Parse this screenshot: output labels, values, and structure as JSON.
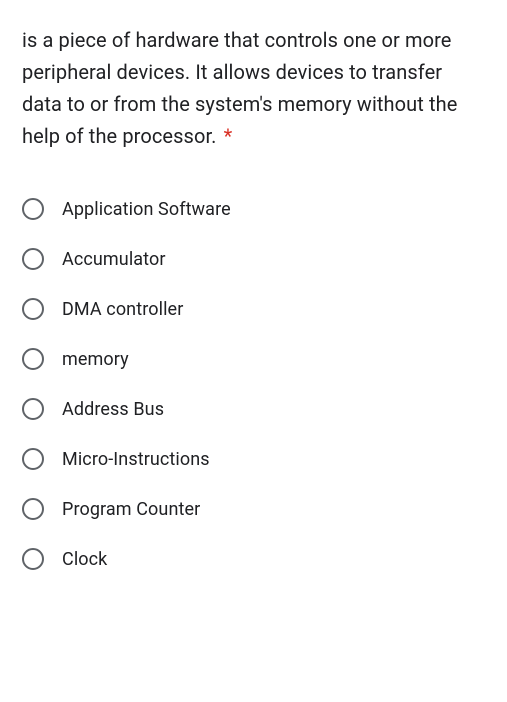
{
  "question": {
    "text": "is a piece of hardware that controls one or more peripheral devices. It allows devices to transfer data to or from the system's memory without the help of the processor.",
    "required_marker": "*"
  },
  "options": [
    {
      "label": "Application Software"
    },
    {
      "label": "Accumulator"
    },
    {
      "label": "DMA controller"
    },
    {
      "label": "memory"
    },
    {
      "label": "Address Bus"
    },
    {
      "label": "Micro-Instructions"
    },
    {
      "label": "Program Counter"
    },
    {
      "label": "Clock"
    }
  ]
}
